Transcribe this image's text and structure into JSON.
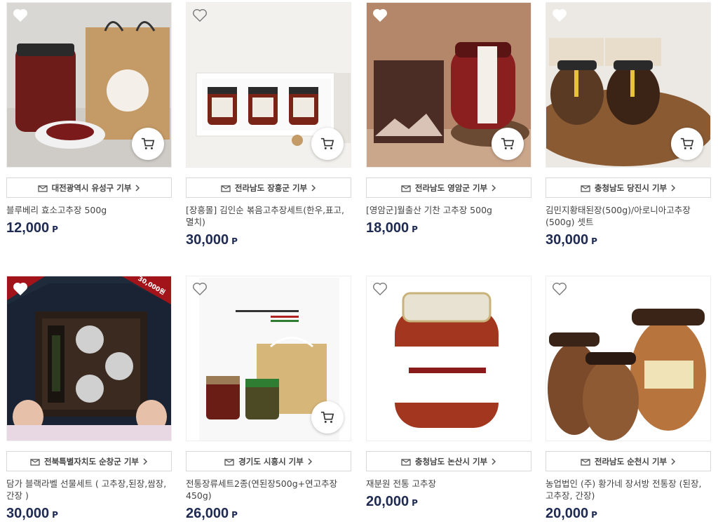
{
  "products": [
    {
      "region": "대전광역시 유성구 기부",
      "name": "블루베리 효소고추장 500g",
      "price": "12,000",
      "unit": "P"
    },
    {
      "region": "전라남도 장흥군 기부",
      "name": "[장흥몰] 김인순 볶음고추장세트(한우,표고,멸치)",
      "price": "30,000",
      "unit": "P"
    },
    {
      "region": "전라남도 영암군 기부",
      "name": "[영암군]월출산 기찬 고추장 500g",
      "price": "18,000",
      "unit": "P"
    },
    {
      "region": "충청남도 당진시 기부",
      "name": "김민지황태된장(500g)/아로니아고추장(500g) 셋트",
      "price": "30,000",
      "unit": "P"
    },
    {
      "region": "전북특별자치도 순창군 기부",
      "name": "담가 블랙라벨 선물세트 ( 고추장,된장,쌈장,간장 )",
      "price": "30,000",
      "unit": "P",
      "ribbon": "30,000원"
    },
    {
      "region": "경기도 시흥시 기부",
      "name": "전통장류세트2종(연된장500g+연고추장450g)",
      "price": "26,000",
      "unit": "P"
    },
    {
      "region": "충청남도 논산시 기부",
      "name": "재분원 전통 고추장",
      "price": "20,000",
      "unit": "P"
    },
    {
      "region": "전라남도 순천시 기부",
      "name": "농업법인 (주) 황가네 장서방 전통장 (된장, 고추장, 간장)",
      "price": "20,000",
      "unit": "P"
    }
  ],
  "icons": {
    "wishlist": "heart-icon",
    "cart": "cart-icon",
    "donate": "gift-box-icon",
    "arrow": "chevron-right-icon"
  },
  "colors": {
    "price": "#1e2a52",
    "border": "#d8d8d8"
  }
}
